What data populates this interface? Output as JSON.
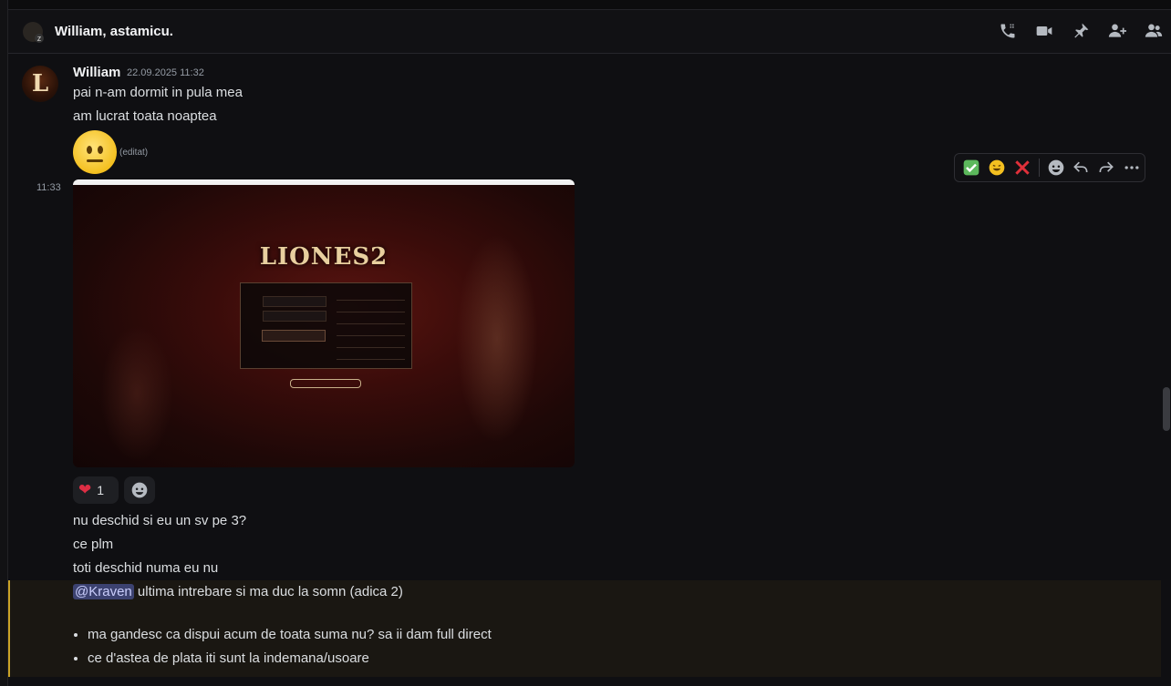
{
  "header": {
    "channel_title": "William, astamicu.",
    "icons": [
      "phone-call-icon",
      "video-call-icon",
      "pin-icon",
      "add-friends-icon",
      "members-icon"
    ]
  },
  "message_group": {
    "avatar_letter": "L",
    "author": "William",
    "timestamp": "22.09.2025 11:32",
    "lines": [
      "pai n-am dormit in pula mea",
      "am lucrat toata noaptea"
    ],
    "edited_label": "(editat)",
    "hover_time": "11:33",
    "image_logo": "LIONES2",
    "reaction": {
      "emoji": "heart",
      "count": "1"
    },
    "followups": [
      "nu deschid si eu un sv pe 3?",
      "ce plm",
      "toti deschid numa eu nu"
    ],
    "mention": "@Kraven",
    "mention_text": " ultima intrebare si ma duc la somn (adica 2)",
    "bullets": [
      "ma gandesc ca dispui acum de toata suma nu? sa ii dam full direct",
      "ce d'astea de plata iti sunt la indemana/usoare"
    ]
  },
  "toolbar": {
    "items": [
      "check-emoji",
      "rofl-emoji",
      "cross-emoji",
      "add-reaction-icon",
      "reply-icon",
      "forward-icon",
      "more-icon"
    ]
  },
  "colors": {
    "background": "#0f0f12",
    "mention_bg": "#3c4270",
    "highlight_border": "#c9a227"
  }
}
